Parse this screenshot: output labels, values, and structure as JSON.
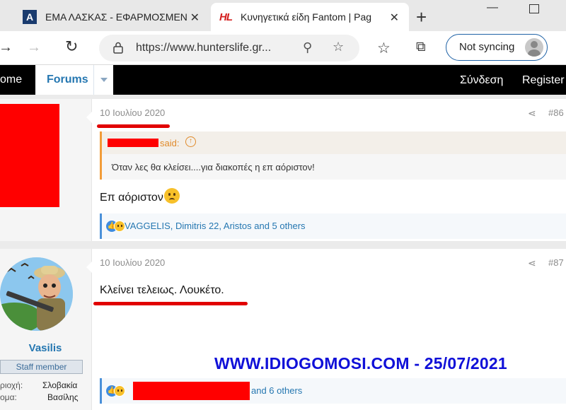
{
  "browser": {
    "tabs": [
      {
        "title": "ΕΜΑ ΛΑΣΚΑΣ - ΕΦΑΡΜΟΣΜΕΝ",
        "favicon": "A"
      },
      {
        "title": "Κυνηγετικά είδη Fantom | Pag",
        "favicon": "HL"
      }
    ],
    "new_tab": "+",
    "address": "https://www.hunterslife.gr...",
    "not_syncing": "Not syncing"
  },
  "nav": {
    "home": "ome",
    "forums": "Forums",
    "login": "Σύνδεση",
    "register": "Register"
  },
  "posts": [
    {
      "date": "10 Ιουλίου 2020",
      "number": "#86",
      "quote_said": "said:",
      "quote_text": "Όταν λες θα κλείσει....για διακοπές η επ αόριστον!",
      "body": "Επ αόριστον",
      "reactions": "VAGGELIS, Dimitris 22, Aristos and 5 others"
    },
    {
      "date": "10 Ιουλίου 2020",
      "number": "#87",
      "body": "Κλείνει τελειως. Λουκέτο.",
      "reactions": "and 6 others",
      "user": {
        "name": "Vasilis",
        "title": "Staff member",
        "fields": [
          {
            "label": "ριοχή:",
            "value": "Σλοβακία"
          },
          {
            "label": "ομα:",
            "value": "Βασίλης"
          }
        ]
      }
    }
  ],
  "watermark": "WWW.IDIOGOMOSI.COM - 25/07/2021",
  "colors": {
    "redaction": "#ff0000",
    "link": "#2577b1",
    "watermark": "#1010d8",
    "quote_accent": "#f29c38"
  }
}
